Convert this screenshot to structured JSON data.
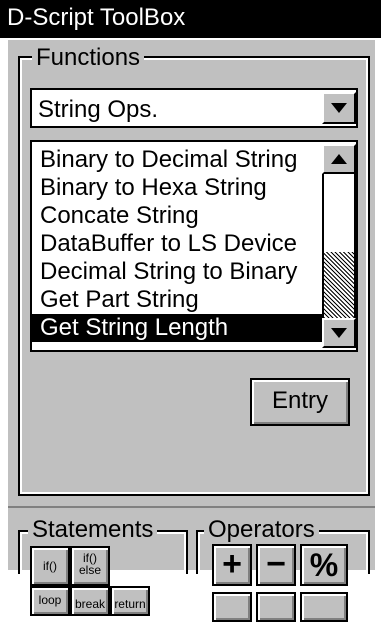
{
  "window": {
    "title": "D-Script ToolBox"
  },
  "functions": {
    "label": "Functions",
    "category": "String Ops.",
    "items": [
      "Binary to Decimal String",
      "Binary to Hexa String",
      "Concate String",
      "DataBuffer to LS Device",
      "Decimal String to Binary",
      "Get Part String",
      "Get String Length"
    ],
    "selected_index": 6,
    "entry_label": "Entry"
  },
  "statements": {
    "label": "Statements",
    "buttons": [
      {
        "line1": "if()",
        "line2": ""
      },
      {
        "line1": "if()",
        "line2": "else"
      },
      {
        "line1": "loop",
        "line2": ""
      },
      {
        "line1": "break",
        "line2": ""
      },
      {
        "line1": "return",
        "line2": ""
      }
    ]
  },
  "operators": {
    "label": "Operators",
    "buttons": [
      "+",
      "−",
      "%"
    ]
  },
  "icons": {
    "dropdown_arrow": "chevron-down-icon",
    "scroll_up": "chevron-up-icon",
    "scroll_down": "chevron-down-icon"
  },
  "colors": {
    "titlebar_bg": "#000000",
    "panel_bg": "#c0c0c0",
    "selection_bg": "#000000"
  }
}
